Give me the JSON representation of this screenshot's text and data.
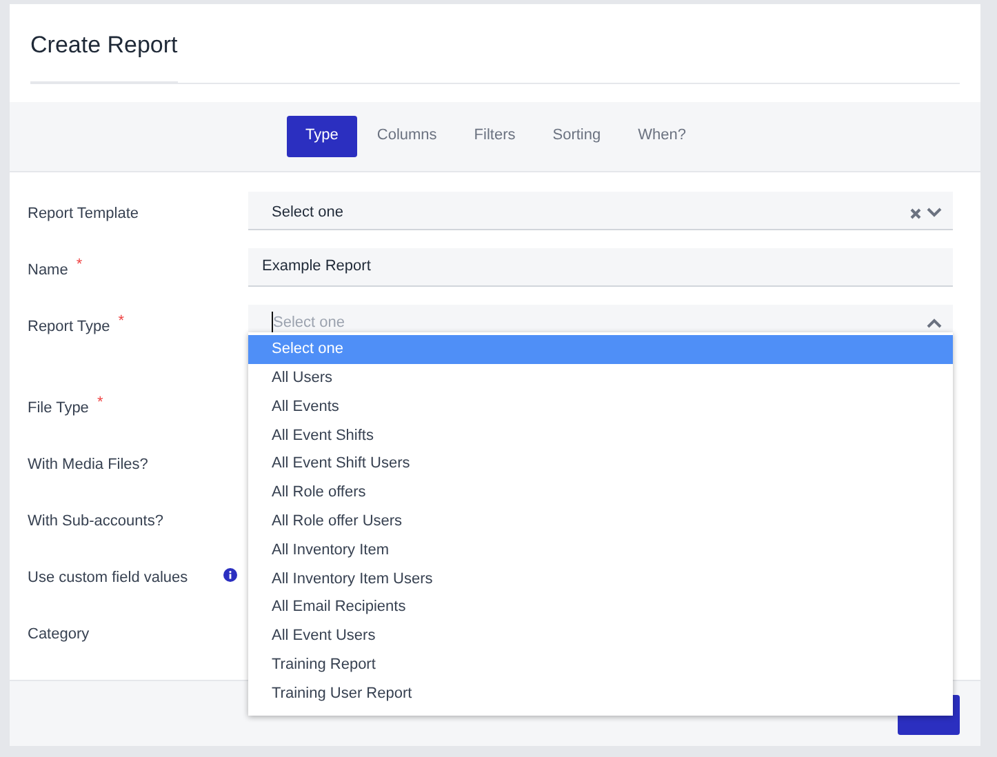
{
  "title": "Create Report",
  "tabs": [
    {
      "label": "Type",
      "selected": true
    },
    {
      "label": "Columns",
      "selected": false
    },
    {
      "label": "Filters",
      "selected": false
    },
    {
      "label": "Sorting",
      "selected": false
    },
    {
      "label": "When?",
      "selected": false
    }
  ],
  "fields": [
    {
      "label": "Report Template",
      "kind": "select",
      "value": "Select one"
    },
    {
      "label": "Name",
      "required_mark": "*",
      "kind": "text",
      "value": "Example Report"
    },
    {
      "label": "Report Type",
      "required_mark": "*",
      "kind": "open-select",
      "placeholder": "Select one"
    },
    {
      "label": "File Type",
      "required_mark": "*",
      "kind": "hidden"
    },
    {
      "label": "With Media Files?",
      "kind": "hidden"
    },
    {
      "label": "With Sub-accounts?",
      "kind": "hidden"
    },
    {
      "label": "Use custom field values",
      "kind": "hidden",
      "info": true
    },
    {
      "label": "Category",
      "kind": "hidden"
    }
  ],
  "dropdown": [
    {
      "label": "Select one",
      "selected": true
    },
    {
      "label": "All Users",
      "selected": false
    },
    {
      "label": "All Events",
      "selected": false
    },
    {
      "label": "All Event Shifts",
      "selected": false
    },
    {
      "label": "All Event Shift Users",
      "selected": false
    },
    {
      "label": "All Role offers",
      "selected": false
    },
    {
      "label": "All Role offer Users",
      "selected": false
    },
    {
      "label": "All Inventory Item",
      "selected": false
    },
    {
      "label": "All Inventory Item Users",
      "selected": false
    },
    {
      "label": "All Email Recipients",
      "selected": false
    },
    {
      "label": "All Event Users",
      "selected": false
    },
    {
      "label": "Training Report",
      "selected": false
    },
    {
      "label": "Training User Report",
      "selected": false
    }
  ]
}
